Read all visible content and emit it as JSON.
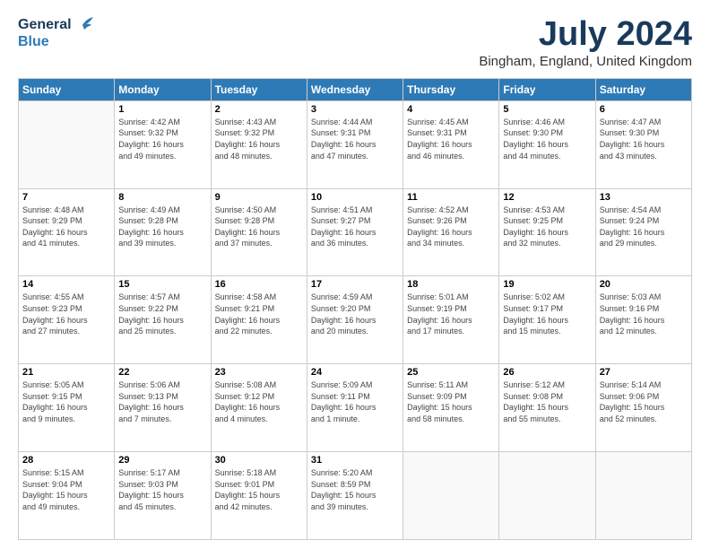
{
  "header": {
    "logo_line1": "General",
    "logo_line2": "Blue",
    "month": "July 2024",
    "location": "Bingham, England, United Kingdom"
  },
  "days_of_week": [
    "Sunday",
    "Monday",
    "Tuesday",
    "Wednesday",
    "Thursday",
    "Friday",
    "Saturday"
  ],
  "weeks": [
    [
      {
        "day": "",
        "info": ""
      },
      {
        "day": "1",
        "info": "Sunrise: 4:42 AM\nSunset: 9:32 PM\nDaylight: 16 hours\nand 49 minutes."
      },
      {
        "day": "2",
        "info": "Sunrise: 4:43 AM\nSunset: 9:32 PM\nDaylight: 16 hours\nand 48 minutes."
      },
      {
        "day": "3",
        "info": "Sunrise: 4:44 AM\nSunset: 9:31 PM\nDaylight: 16 hours\nand 47 minutes."
      },
      {
        "day": "4",
        "info": "Sunrise: 4:45 AM\nSunset: 9:31 PM\nDaylight: 16 hours\nand 46 minutes."
      },
      {
        "day": "5",
        "info": "Sunrise: 4:46 AM\nSunset: 9:30 PM\nDaylight: 16 hours\nand 44 minutes."
      },
      {
        "day": "6",
        "info": "Sunrise: 4:47 AM\nSunset: 9:30 PM\nDaylight: 16 hours\nand 43 minutes."
      }
    ],
    [
      {
        "day": "7",
        "info": "Sunrise: 4:48 AM\nSunset: 9:29 PM\nDaylight: 16 hours\nand 41 minutes."
      },
      {
        "day": "8",
        "info": "Sunrise: 4:49 AM\nSunset: 9:28 PM\nDaylight: 16 hours\nand 39 minutes."
      },
      {
        "day": "9",
        "info": "Sunrise: 4:50 AM\nSunset: 9:28 PM\nDaylight: 16 hours\nand 37 minutes."
      },
      {
        "day": "10",
        "info": "Sunrise: 4:51 AM\nSunset: 9:27 PM\nDaylight: 16 hours\nand 36 minutes."
      },
      {
        "day": "11",
        "info": "Sunrise: 4:52 AM\nSunset: 9:26 PM\nDaylight: 16 hours\nand 34 minutes."
      },
      {
        "day": "12",
        "info": "Sunrise: 4:53 AM\nSunset: 9:25 PM\nDaylight: 16 hours\nand 32 minutes."
      },
      {
        "day": "13",
        "info": "Sunrise: 4:54 AM\nSunset: 9:24 PM\nDaylight: 16 hours\nand 29 minutes."
      }
    ],
    [
      {
        "day": "14",
        "info": "Sunrise: 4:55 AM\nSunset: 9:23 PM\nDaylight: 16 hours\nand 27 minutes."
      },
      {
        "day": "15",
        "info": "Sunrise: 4:57 AM\nSunset: 9:22 PM\nDaylight: 16 hours\nand 25 minutes."
      },
      {
        "day": "16",
        "info": "Sunrise: 4:58 AM\nSunset: 9:21 PM\nDaylight: 16 hours\nand 22 minutes."
      },
      {
        "day": "17",
        "info": "Sunrise: 4:59 AM\nSunset: 9:20 PM\nDaylight: 16 hours\nand 20 minutes."
      },
      {
        "day": "18",
        "info": "Sunrise: 5:01 AM\nSunset: 9:19 PM\nDaylight: 16 hours\nand 17 minutes."
      },
      {
        "day": "19",
        "info": "Sunrise: 5:02 AM\nSunset: 9:17 PM\nDaylight: 16 hours\nand 15 minutes."
      },
      {
        "day": "20",
        "info": "Sunrise: 5:03 AM\nSunset: 9:16 PM\nDaylight: 16 hours\nand 12 minutes."
      }
    ],
    [
      {
        "day": "21",
        "info": "Sunrise: 5:05 AM\nSunset: 9:15 PM\nDaylight: 16 hours\nand 9 minutes."
      },
      {
        "day": "22",
        "info": "Sunrise: 5:06 AM\nSunset: 9:13 PM\nDaylight: 16 hours\nand 7 minutes."
      },
      {
        "day": "23",
        "info": "Sunrise: 5:08 AM\nSunset: 9:12 PM\nDaylight: 16 hours\nand 4 minutes."
      },
      {
        "day": "24",
        "info": "Sunrise: 5:09 AM\nSunset: 9:11 PM\nDaylight: 16 hours\nand 1 minute."
      },
      {
        "day": "25",
        "info": "Sunrise: 5:11 AM\nSunset: 9:09 PM\nDaylight: 15 hours\nand 58 minutes."
      },
      {
        "day": "26",
        "info": "Sunrise: 5:12 AM\nSunset: 9:08 PM\nDaylight: 15 hours\nand 55 minutes."
      },
      {
        "day": "27",
        "info": "Sunrise: 5:14 AM\nSunset: 9:06 PM\nDaylight: 15 hours\nand 52 minutes."
      }
    ],
    [
      {
        "day": "28",
        "info": "Sunrise: 5:15 AM\nSunset: 9:04 PM\nDaylight: 15 hours\nand 49 minutes."
      },
      {
        "day": "29",
        "info": "Sunrise: 5:17 AM\nSunset: 9:03 PM\nDaylight: 15 hours\nand 45 minutes."
      },
      {
        "day": "30",
        "info": "Sunrise: 5:18 AM\nSunset: 9:01 PM\nDaylight: 15 hours\nand 42 minutes."
      },
      {
        "day": "31",
        "info": "Sunrise: 5:20 AM\nSunset: 8:59 PM\nDaylight: 15 hours\nand 39 minutes."
      },
      {
        "day": "",
        "info": ""
      },
      {
        "day": "",
        "info": ""
      },
      {
        "day": "",
        "info": ""
      }
    ]
  ]
}
